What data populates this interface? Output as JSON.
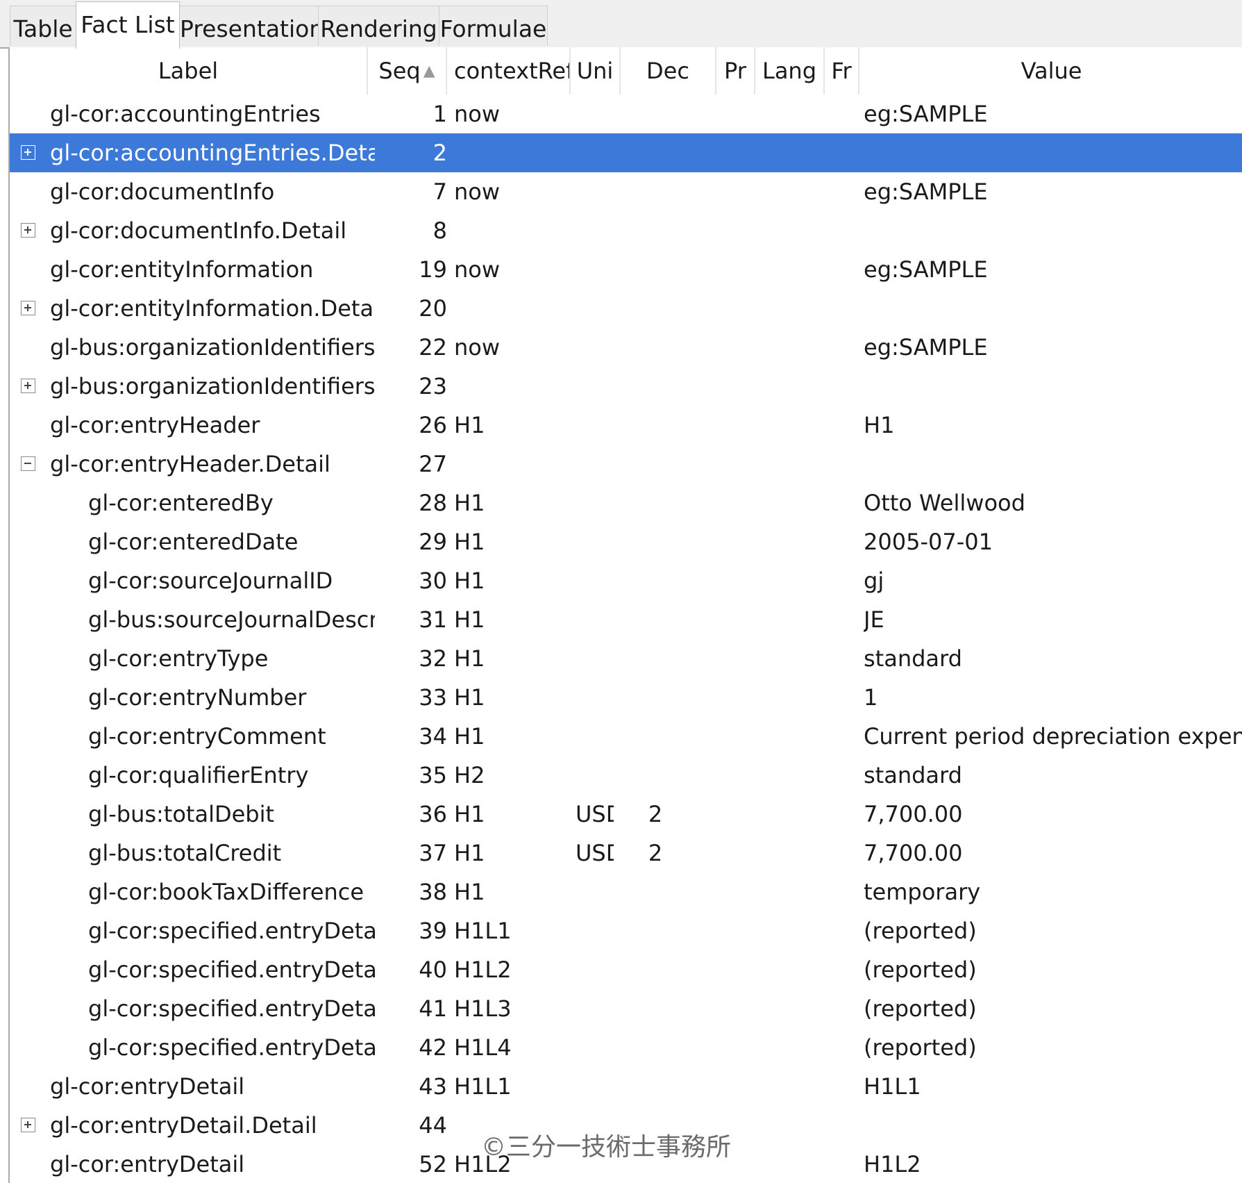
{
  "tabs": [
    {
      "label": "Table",
      "active": false
    },
    {
      "label": "Fact List",
      "active": true
    },
    {
      "label": "Presentation",
      "active": false
    },
    {
      "label": "Rendering",
      "active": false
    },
    {
      "label": "Formulae",
      "active": false
    }
  ],
  "columns": {
    "label": "Label",
    "seq": "Seq",
    "contextRef": "contextRef",
    "unit": "Uni",
    "dec": "Dec",
    "prec": "Pr",
    "lang": "Lang",
    "fr": "Fr",
    "value": "Value"
  },
  "sort": {
    "column": "Seq",
    "direction": "ascending"
  },
  "rows": [
    {
      "label": "gl-cor:accountingEntries",
      "seq": "1",
      "contextRef": "now",
      "value": "eg:SAMPLE",
      "level": 0
    },
    {
      "label": "gl-cor:accountingEntries.Detail",
      "seq": "2",
      "level": 0,
      "toggle": "collapsed",
      "selected": true
    },
    {
      "label": "gl-cor:documentInfo",
      "seq": "7",
      "contextRef": "now",
      "value": "eg:SAMPLE",
      "level": 0
    },
    {
      "label": "gl-cor:documentInfo.Detail",
      "seq": "8",
      "level": 0,
      "toggle": "collapsed"
    },
    {
      "label": "gl-cor:entityInformation",
      "seq": "19",
      "contextRef": "now",
      "value": "eg:SAMPLE",
      "level": 0
    },
    {
      "label": "gl-cor:entityInformation.Detail",
      "seq": "20",
      "level": 0,
      "toggle": "collapsed"
    },
    {
      "label": "gl-bus:organizationIdentifiers",
      "seq": "22",
      "contextRef": "now",
      "value": "eg:SAMPLE",
      "level": 0
    },
    {
      "label": "gl-bus:organizationIdentifiers.Detail",
      "seq": "23",
      "level": 0,
      "toggle": "collapsed"
    },
    {
      "label": "gl-cor:entryHeader",
      "seq": "26",
      "contextRef": "H1",
      "value": "H1",
      "level": 0
    },
    {
      "label": "gl-cor:entryHeader.Detail",
      "seq": "27",
      "level": 0,
      "toggle": "expanded"
    },
    {
      "label": "gl-cor:enteredBy",
      "seq": "28",
      "contextRef": "H1",
      "value": "Otto Wellwood",
      "level": 1
    },
    {
      "label": "gl-cor:enteredDate",
      "seq": "29",
      "contextRef": "H1",
      "value": "2005-07-01",
      "level": 1
    },
    {
      "label": "gl-cor:sourceJournalID",
      "seq": "30",
      "contextRef": "H1",
      "value": "gj",
      "level": 1
    },
    {
      "label": "gl-bus:sourceJournalDescription",
      "seq": "31",
      "contextRef": "H1",
      "value": "JE",
      "level": 1
    },
    {
      "label": "gl-cor:entryType",
      "seq": "32",
      "contextRef": "H1",
      "value": "standard",
      "level": 1
    },
    {
      "label": "gl-cor:entryNumber",
      "seq": "33",
      "contextRef": "H1",
      "value": "1",
      "level": 1
    },
    {
      "label": "gl-cor:entryComment",
      "seq": "34",
      "contextRef": "H1",
      "value": "Current period depreciation expense",
      "level": 1
    },
    {
      "label": "gl-cor:qualifierEntry",
      "seq": "35",
      "contextRef": "H2",
      "value": "standard",
      "level": 1
    },
    {
      "label": "gl-bus:totalDebit",
      "seq": "36",
      "contextRef": "H1",
      "unit": "USD",
      "dec": "2",
      "value": "7,700.00",
      "level": 1
    },
    {
      "label": "gl-bus:totalCredit",
      "seq": "37",
      "contextRef": "H1",
      "unit": "USD",
      "dec": "2",
      "value": "7,700.00",
      "level": 1
    },
    {
      "label": "gl-cor:bookTaxDifference",
      "seq": "38",
      "contextRef": "H1",
      "value": "temporary",
      "level": 1
    },
    {
      "label": "gl-cor:specified.entryDetail",
      "seq": "39",
      "contextRef": "H1L1",
      "value": "(reported)",
      "level": 1
    },
    {
      "label": "gl-cor:specified.entryDetail",
      "seq": "40",
      "contextRef": "H1L2",
      "value": "(reported)",
      "level": 1
    },
    {
      "label": "gl-cor:specified.entryDetail",
      "seq": "41",
      "contextRef": "H1L3",
      "value": "(reported)",
      "level": 1
    },
    {
      "label": "gl-cor:specified.entryDetail",
      "seq": "42",
      "contextRef": "H1L4",
      "value": "(reported)",
      "level": 1
    },
    {
      "label": "gl-cor:entryDetail",
      "seq": "43",
      "contextRef": "H1L1",
      "value": "H1L1",
      "level": 0
    },
    {
      "label": "gl-cor:entryDetail.Detail",
      "seq": "44",
      "level": 0,
      "toggle": "collapsed"
    },
    {
      "label": "gl-cor:entryDetail",
      "seq": "52",
      "contextRef": "H1L2",
      "value": "H1L2",
      "level": 0
    }
  ],
  "watermark": "©三分一技術士事務所",
  "colors": {
    "selection": "#3d79d8",
    "selection_text": "#ffffff"
  }
}
